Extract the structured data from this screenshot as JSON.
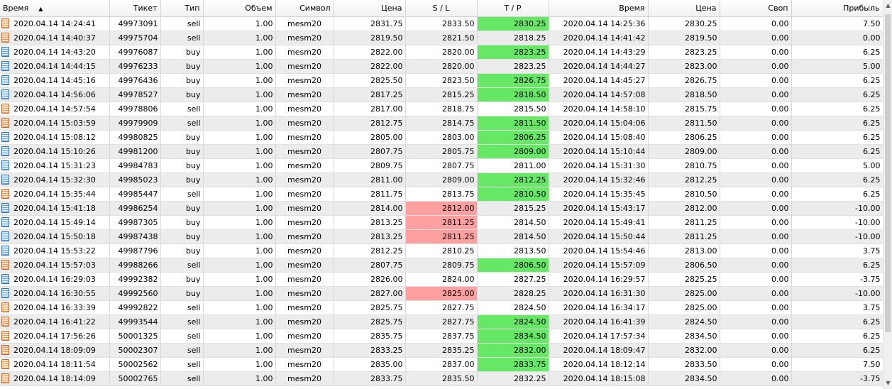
{
  "colors": {
    "tp_hit": "#66e866",
    "sl_hit": "#ffa0a0",
    "row_alt": "#ececec"
  },
  "columns": {
    "open_time": "Время",
    "ticket": "Тикет",
    "type": "Тип",
    "volume": "Объем",
    "symbol": "Символ",
    "open_price": "Цена",
    "sl": "S / L",
    "tp": "T / P",
    "close_time": "Время",
    "close_price": "Цена",
    "swap": "Своп",
    "profit": "Прибыль"
  },
  "sort_indicator": "▲",
  "rows": [
    {
      "open_time": "2020.04.14 14:24:41",
      "ticket": "49973091",
      "type": "sell",
      "volume": "1.00",
      "symbol": "mesm20",
      "open_price": "2831.75",
      "sl": "2833.50",
      "tp": "2830.25",
      "close_time": "2020.04.14 14:25:36",
      "close_price": "2830.25",
      "swap": "0.00",
      "profit": "7.50",
      "hit": "tp"
    },
    {
      "open_time": "2020.04.14 14:40:37",
      "ticket": "49975704",
      "type": "sell",
      "volume": "1.00",
      "symbol": "mesm20",
      "open_price": "2819.50",
      "sl": "2821.50",
      "tp": "2818.25",
      "close_time": "2020.04.14 14:41:42",
      "close_price": "2819.50",
      "swap": "0.00",
      "profit": "0.00",
      "hit": ""
    },
    {
      "open_time": "2020.04.14 14:43:20",
      "ticket": "49976087",
      "type": "buy",
      "volume": "1.00",
      "symbol": "mesm20",
      "open_price": "2822.00",
      "sl": "2820.00",
      "tp": "2823.25",
      "close_time": "2020.04.14 14:43:29",
      "close_price": "2823.25",
      "swap": "0.00",
      "profit": "6.25",
      "hit": "tp"
    },
    {
      "open_time": "2020.04.14 14:44:15",
      "ticket": "49976233",
      "type": "buy",
      "volume": "1.00",
      "symbol": "mesm20",
      "open_price": "2822.00",
      "sl": "2820.00",
      "tp": "2823.25",
      "close_time": "2020.04.14 14:44:27",
      "close_price": "2823.00",
      "swap": "0.00",
      "profit": "5.00",
      "hit": ""
    },
    {
      "open_time": "2020.04.14 14:45:16",
      "ticket": "49976436",
      "type": "buy",
      "volume": "1.00",
      "symbol": "mesm20",
      "open_price": "2825.50",
      "sl": "2823.50",
      "tp": "2826.75",
      "close_time": "2020.04.14 14:45:27",
      "close_price": "2826.75",
      "swap": "0.00",
      "profit": "6.25",
      "hit": "tp"
    },
    {
      "open_time": "2020.04.14 14:56:06",
      "ticket": "49978527",
      "type": "buy",
      "volume": "1.00",
      "symbol": "mesm20",
      "open_price": "2817.25",
      "sl": "2815.25",
      "tp": "2818.50",
      "close_time": "2020.04.14 14:57:08",
      "close_price": "2818.50",
      "swap": "0.00",
      "profit": "6.25",
      "hit": "tp"
    },
    {
      "open_time": "2020.04.14 14:57:54",
      "ticket": "49978806",
      "type": "sell",
      "volume": "1.00",
      "symbol": "mesm20",
      "open_price": "2817.00",
      "sl": "2818.75",
      "tp": "2815.50",
      "close_time": "2020.04.14 14:58:10",
      "close_price": "2815.75",
      "swap": "0.00",
      "profit": "6.25",
      "hit": ""
    },
    {
      "open_time": "2020.04.14 15:03:59",
      "ticket": "49979909",
      "type": "sell",
      "volume": "1.00",
      "symbol": "mesm20",
      "open_price": "2812.75",
      "sl": "2814.75",
      "tp": "2811.50",
      "close_time": "2020.04.14 15:04:06",
      "close_price": "2811.50",
      "swap": "0.00",
      "profit": "6.25",
      "hit": "tp"
    },
    {
      "open_time": "2020.04.14 15:08:12",
      "ticket": "49980825",
      "type": "buy",
      "volume": "1.00",
      "symbol": "mesm20",
      "open_price": "2805.00",
      "sl": "2803.00",
      "tp": "2806.25",
      "close_time": "2020.04.14 15:08:40",
      "close_price": "2806.25",
      "swap": "0.00",
      "profit": "6.25",
      "hit": "tp"
    },
    {
      "open_time": "2020.04.14 15:10:26",
      "ticket": "49981200",
      "type": "buy",
      "volume": "1.00",
      "symbol": "mesm20",
      "open_price": "2807.75",
      "sl": "2805.75",
      "tp": "2809.00",
      "close_time": "2020.04.14 15:10:44",
      "close_price": "2809.00",
      "swap": "0.00",
      "profit": "6.25",
      "hit": "tp"
    },
    {
      "open_time": "2020.04.14 15:31:23",
      "ticket": "49984783",
      "type": "buy",
      "volume": "1.00",
      "symbol": "mesm20",
      "open_price": "2809.75",
      "sl": "2807.75",
      "tp": "2811.00",
      "close_time": "2020.04.14 15:31:30",
      "close_price": "2810.75",
      "swap": "0.00",
      "profit": "5.00",
      "hit": ""
    },
    {
      "open_time": "2020.04.14 15:32:30",
      "ticket": "49985023",
      "type": "buy",
      "volume": "1.00",
      "symbol": "mesm20",
      "open_price": "2811.00",
      "sl": "2809.00",
      "tp": "2812.25",
      "close_time": "2020.04.14 15:32:46",
      "close_price": "2812.25",
      "swap": "0.00",
      "profit": "6.25",
      "hit": "tp"
    },
    {
      "open_time": "2020.04.14 15:35:44",
      "ticket": "49985447",
      "type": "sell",
      "volume": "1.00",
      "symbol": "mesm20",
      "open_price": "2811.75",
      "sl": "2813.75",
      "tp": "2810.50",
      "close_time": "2020.04.14 15:35:45",
      "close_price": "2810.50",
      "swap": "0.00",
      "profit": "6.25",
      "hit": "tp"
    },
    {
      "open_time": "2020.04.14 15:41:18",
      "ticket": "49986254",
      "type": "buy",
      "volume": "1.00",
      "symbol": "mesm20",
      "open_price": "2814.00",
      "sl": "2812.00",
      "tp": "2815.25",
      "close_time": "2020.04.14 15:43:17",
      "close_price": "2812.00",
      "swap": "0.00",
      "profit": "-10.00",
      "hit": "sl"
    },
    {
      "open_time": "2020.04.14 15:49:14",
      "ticket": "49987305",
      "type": "buy",
      "volume": "1.00",
      "symbol": "mesm20",
      "open_price": "2813.25",
      "sl": "2811.25",
      "tp": "2814.50",
      "close_time": "2020.04.14 15:49:41",
      "close_price": "2811.25",
      "swap": "0.00",
      "profit": "-10.00",
      "hit": "sl"
    },
    {
      "open_time": "2020.04.14 15:50:18",
      "ticket": "49987438",
      "type": "buy",
      "volume": "1.00",
      "symbol": "mesm20",
      "open_price": "2813.25",
      "sl": "2811.25",
      "tp": "2814.50",
      "close_time": "2020.04.14 15:50:44",
      "close_price": "2811.25",
      "swap": "0.00",
      "profit": "-10.00",
      "hit": "sl"
    },
    {
      "open_time": "2020.04.14 15:53:22",
      "ticket": "49987796",
      "type": "buy",
      "volume": "1.00",
      "symbol": "mesm20",
      "open_price": "2812.25",
      "sl": "2810.25",
      "tp": "2813.50",
      "close_time": "2020.04.14 15:54:46",
      "close_price": "2813.00",
      "swap": "0.00",
      "profit": "3.75",
      "hit": ""
    },
    {
      "open_time": "2020.04.14 15:57:03",
      "ticket": "49988266",
      "type": "sell",
      "volume": "1.00",
      "symbol": "mesm20",
      "open_price": "2807.75",
      "sl": "2809.75",
      "tp": "2806.50",
      "close_time": "2020.04.14 15:57:09",
      "close_price": "2806.50",
      "swap": "0.00",
      "profit": "6.25",
      "hit": "tp"
    },
    {
      "open_time": "2020.04.14 16:29:03",
      "ticket": "49992382",
      "type": "buy",
      "volume": "1.00",
      "symbol": "mesm20",
      "open_price": "2826.00",
      "sl": "2824.00",
      "tp": "2827.25",
      "close_time": "2020.04.14 16:29:57",
      "close_price": "2825.25",
      "swap": "0.00",
      "profit": "-3.75",
      "hit": ""
    },
    {
      "open_time": "2020.04.14 16:30:55",
      "ticket": "49992560",
      "type": "buy",
      "volume": "1.00",
      "symbol": "mesm20",
      "open_price": "2827.00",
      "sl": "2825.00",
      "tp": "2828.25",
      "close_time": "2020.04.14 16:31:30",
      "close_price": "2825.00",
      "swap": "0.00",
      "profit": "-10.00",
      "hit": "sl"
    },
    {
      "open_time": "2020.04.14 16:33:39",
      "ticket": "49992822",
      "type": "sell",
      "volume": "1.00",
      "symbol": "mesm20",
      "open_price": "2825.75",
      "sl": "2827.75",
      "tp": "2824.50",
      "close_time": "2020.04.14 16:34:17",
      "close_price": "2825.00",
      "swap": "0.00",
      "profit": "3.75",
      "hit": ""
    },
    {
      "open_time": "2020.04.14 16:41:22",
      "ticket": "49993544",
      "type": "sell",
      "volume": "1.00",
      "symbol": "mesm20",
      "open_price": "2825.75",
      "sl": "2827.75",
      "tp": "2824.50",
      "close_time": "2020.04.14 16:41:39",
      "close_price": "2824.50",
      "swap": "0.00",
      "profit": "6.25",
      "hit": "tp"
    },
    {
      "open_time": "2020.04.14 17:56:26",
      "ticket": "50001325",
      "type": "sell",
      "volume": "1.00",
      "symbol": "mesm20",
      "open_price": "2835.75",
      "sl": "2837.75",
      "tp": "2834.50",
      "close_time": "2020.04.14 17:57:34",
      "close_price": "2834.50",
      "swap": "0.00",
      "profit": "6.25",
      "hit": "tp"
    },
    {
      "open_time": "2020.04.14 18:09:09",
      "ticket": "50002307",
      "type": "sell",
      "volume": "1.00",
      "symbol": "mesm20",
      "open_price": "2833.25",
      "sl": "2835.25",
      "tp": "2832.00",
      "close_time": "2020.04.14 18:09:47",
      "close_price": "2832.00",
      "swap": "0.00",
      "profit": "6.25",
      "hit": "tp"
    },
    {
      "open_time": "2020.04.14 18:11:54",
      "ticket": "50002562",
      "type": "sell",
      "volume": "1.00",
      "symbol": "mesm20",
      "open_price": "2835.00",
      "sl": "2837.00",
      "tp": "2833.75",
      "close_time": "2020.04.14 18:12:14",
      "close_price": "2833.50",
      "swap": "0.00",
      "profit": "7.50",
      "hit": "tp"
    },
    {
      "open_time": "2020.04.14 18:14:09",
      "ticket": "50002765",
      "type": "sell",
      "volume": "1.00",
      "symbol": "mesm20",
      "open_price": "2833.75",
      "sl": "2835.50",
      "tp": "2832.25",
      "close_time": "2020.04.14 18:15:08",
      "close_price": "2834.50",
      "swap": "0.00",
      "profit": "-3.75",
      "hit": ""
    }
  ]
}
